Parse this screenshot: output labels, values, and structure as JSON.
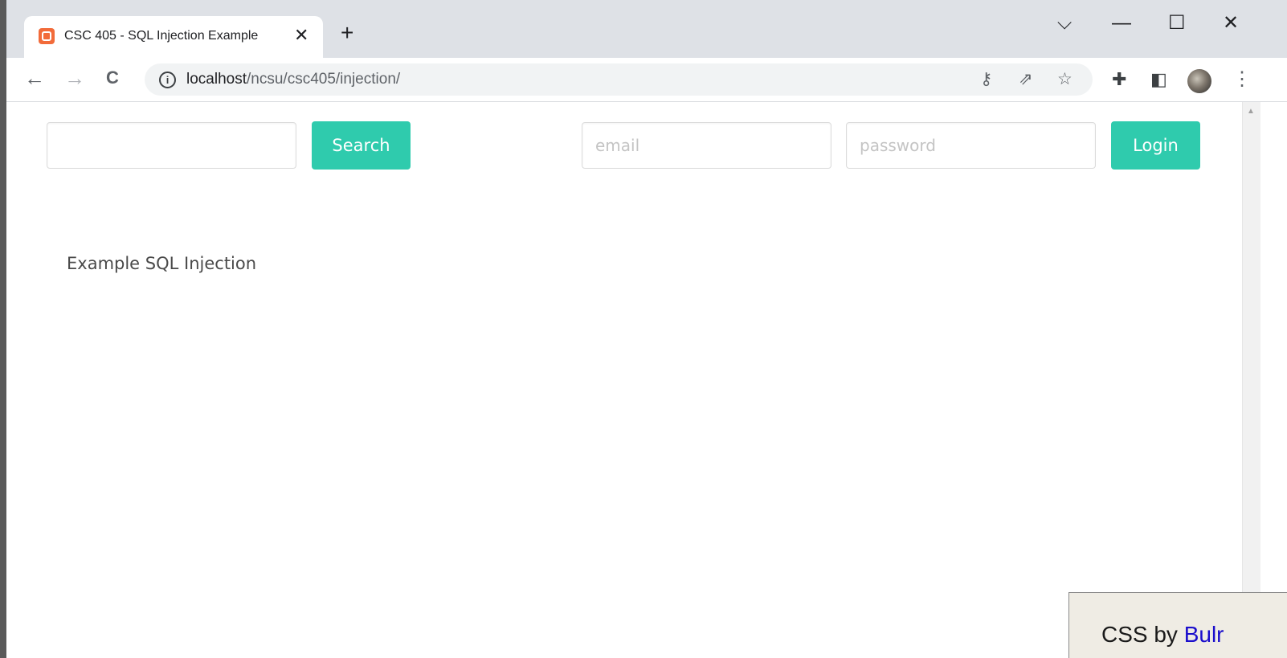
{
  "browser": {
    "tab": {
      "title": "CSC 405 - SQL Injection Example",
      "close": "✕"
    },
    "new_tab": "+",
    "window_controls": {
      "tablist": "⌵",
      "minimize": "—",
      "maximize": "☐",
      "close": "✕"
    },
    "nav": {
      "back": "←",
      "forward": "→",
      "reload": "C"
    },
    "address": {
      "host": "localhost",
      "path": "/ncsu/csc405/injection/"
    },
    "toolbar_icons": [
      "key-icon",
      "share-icon",
      "star-icon",
      "puzzle-icon",
      "sidepanel-icon",
      "avatar",
      "menu-icon"
    ]
  },
  "page": {
    "search": {
      "value": "",
      "button": "Search"
    },
    "login": {
      "email_placeholder": "email",
      "password_placeholder": "password",
      "button": "Login"
    },
    "heading": "Example SQL Injection",
    "footer": {
      "prefix": "CSS by ",
      "link": "Bulr"
    }
  },
  "colors": {
    "accent": "#2fcbad",
    "tab_strip": "#dee1e6",
    "link": "#1a0dcc"
  }
}
